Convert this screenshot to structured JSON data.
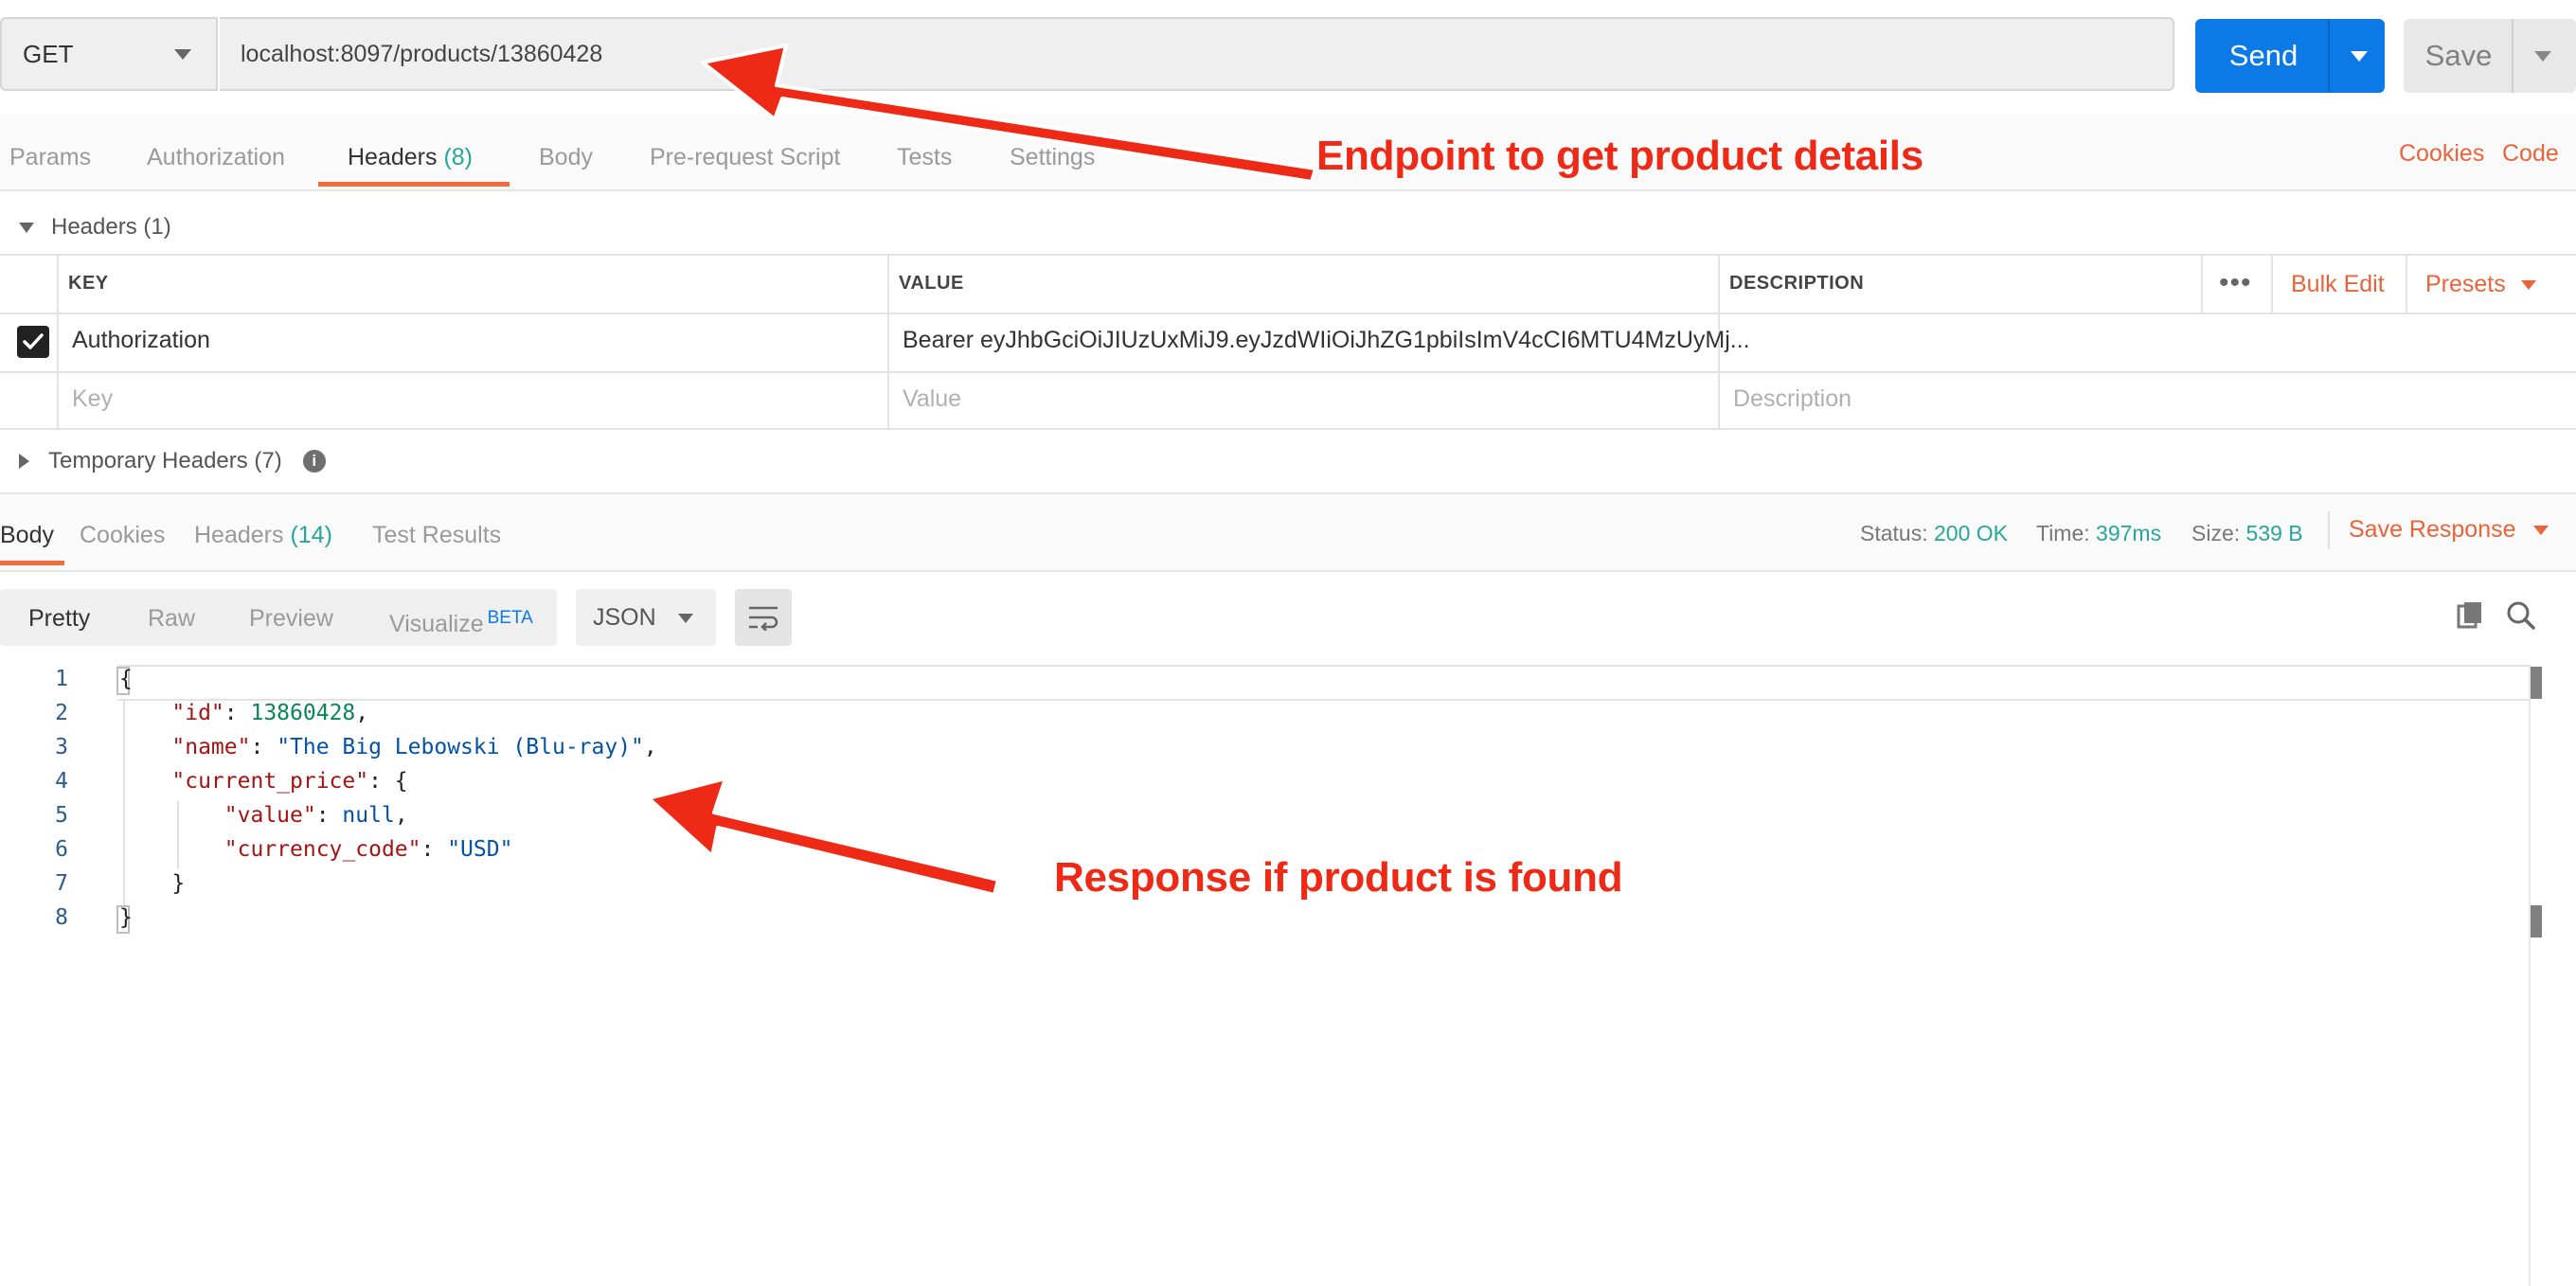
{
  "request": {
    "method": "GET",
    "url": "localhost:8097/products/13860428",
    "send_label": "Send",
    "save_label": "Save"
  },
  "request_tabs": [
    {
      "label": "Params",
      "count": ""
    },
    {
      "label": "Authorization",
      "count": ""
    },
    {
      "label": "Headers",
      "count": "(8)"
    },
    {
      "label": "Body",
      "count": ""
    },
    {
      "label": "Pre-request Script",
      "count": ""
    },
    {
      "label": "Tests",
      "count": ""
    },
    {
      "label": "Settings",
      "count": ""
    }
  ],
  "active_request_tab": "Headers",
  "links": {
    "cookies": "Cookies",
    "code": "Code"
  },
  "headers_section": {
    "title": "Headers",
    "count": "(1)",
    "columns": {
      "key": "KEY",
      "value": "VALUE",
      "description": "DESCRIPTION"
    },
    "more": "•••",
    "bulk_edit": "Bulk Edit",
    "presets": "Presets",
    "rows": [
      {
        "checked": true,
        "key": "Authorization",
        "value": "Bearer eyJhbGciOiJIUzUxMiJ9.eyJzdWIiOiJhZG1pbiIsImV4cCI6MTU4MzUyMj...",
        "description": ""
      }
    ],
    "placeholders": {
      "key": "Key",
      "value": "Value",
      "description": "Description"
    }
  },
  "temporary_headers": {
    "title": "Temporary Headers",
    "count": "(7)",
    "info": "i"
  },
  "response_tabs": [
    {
      "label": "Body",
      "count": ""
    },
    {
      "label": "Cookies",
      "count": ""
    },
    {
      "label": "Headers",
      "count": "(14)"
    },
    {
      "label": "Test Results",
      "count": ""
    }
  ],
  "active_response_tab": "Body",
  "response_meta": {
    "status_label": "Status:",
    "status": "200 OK",
    "time_label": "Time:",
    "time": "397ms",
    "size_label": "Size:",
    "size": "539 B",
    "save_response": "Save Response"
  },
  "view_modes": {
    "pretty": "Pretty",
    "raw": "Raw",
    "preview": "Preview",
    "visualize": "Visualize",
    "beta": "BETA"
  },
  "active_view_mode": "Pretty",
  "format": "JSON",
  "code_lines": [
    "1",
    "2",
    "3",
    "4",
    "5",
    "6",
    "7",
    "8"
  ],
  "code": {
    "open_brace": "{",
    "id_key": "\"id\"",
    "id_val": "13860428",
    "name_key": "\"name\"",
    "name_val": "\"The Big Lebowski (Blu-ray)\"",
    "price_key": "\"current_price\"",
    "value_key": "\"value\"",
    "value_val": "null",
    "currency_key": "\"currency_code\"",
    "currency_val": "\"USD\"",
    "inner_close": "}",
    "close_brace": "}"
  },
  "annotations": {
    "endpoint": "Endpoint to get product details",
    "response": "Response if product is found"
  },
  "colors": {
    "accent": "#f26b3a",
    "send_blue": "#0b7ae6",
    "status_green": "#26a69a",
    "annotation_red": "#ee2a17"
  }
}
